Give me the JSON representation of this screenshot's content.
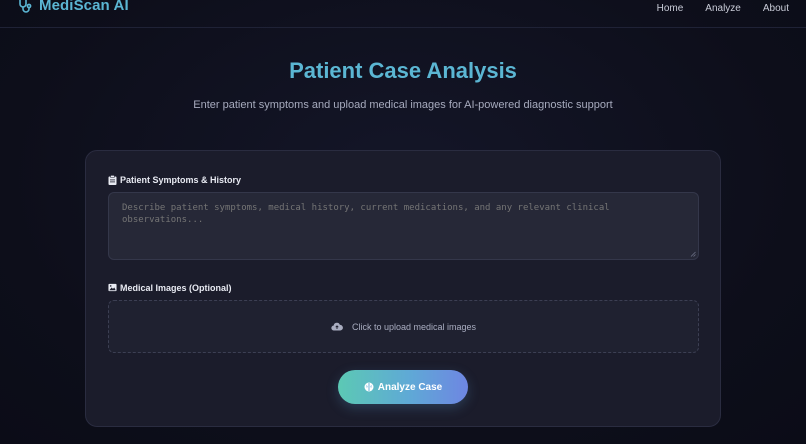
{
  "colors": {
    "brand": "#5bb6d3",
    "background": "#0e0f1c",
    "card": "#1b1c2b",
    "accent_gradient_start": "#5cc9b4",
    "accent_gradient_end": "#6e86e2"
  },
  "header": {
    "brand_name": "MediScan AI",
    "brand_icon": "stethoscope-icon",
    "nav": {
      "home": "Home",
      "analyze": "Analyze",
      "about": "About"
    }
  },
  "hero": {
    "title": "Patient Case Analysis",
    "subtitle": "Enter patient symptoms and upload medical images for AI-powered diagnostic support"
  },
  "form": {
    "symptoms": {
      "label": "Patient Symptoms & History",
      "icon": "clipboard-icon",
      "value": "",
      "placeholder": "Describe patient symptoms, medical history, current medications, and any relevant clinical observations..."
    },
    "images": {
      "label": "Medical Images (Optional)",
      "icon": "image-icon",
      "upload_text": "Click to upload medical images",
      "upload_icon": "cloud-upload-icon"
    },
    "submit": {
      "label": "Analyze Case",
      "icon": "brain-icon"
    }
  }
}
